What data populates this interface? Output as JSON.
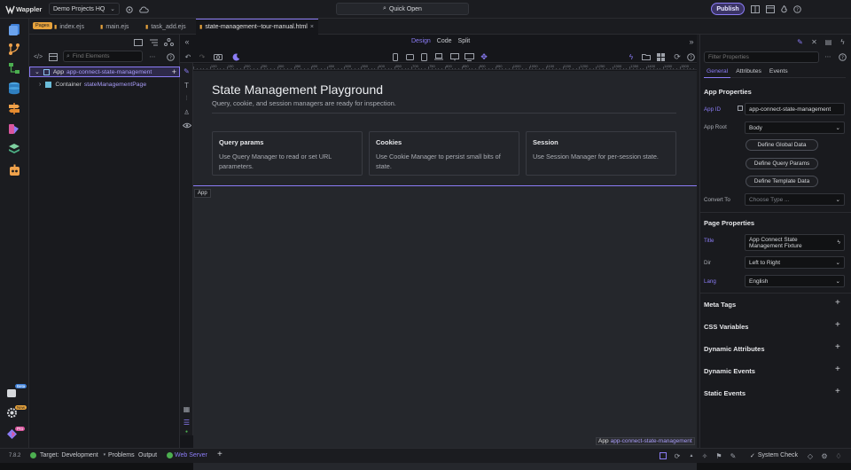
{
  "topbar": {
    "app_name": "Wappler",
    "project": "Demo Projects HQ",
    "quick_open": "Quick Open",
    "publish": "Publish"
  },
  "left_badges": {
    "beta": "Beta",
    "new": "New",
    "pro": "Pro"
  },
  "tabs": {
    "pages_badge": "Pages",
    "files": [
      "index.ejs",
      "main.ejs",
      "task_add.ejs"
    ],
    "active": "state-management--tour-manual.html"
  },
  "panel": {
    "find_placeholder": "Find Elements",
    "tree": {
      "app_label": "App",
      "app_id": "app-connect-state-management",
      "container_label": "Container",
      "container_id": "stateManagementPage"
    }
  },
  "view_modes": {
    "design": "Design",
    "code": "Code",
    "split": "Split"
  },
  "canvas": {
    "title": "State Management Playground",
    "subtitle": "Query, cookie, and session managers are ready for inspection.",
    "cards": [
      {
        "heading": "Query params",
        "text": "Use Query Manager to read or set URL parameters."
      },
      {
        "heading": "Cookies",
        "text": "Use Cookie Manager to persist small bits of state."
      },
      {
        "heading": "Session",
        "text": "Use Session Manager for per-session state."
      }
    ],
    "app_tag": "App",
    "breadcrumb_label": "App",
    "breadcrumb_id": "app-connect-state-management"
  },
  "ruler_ticks": [
    "100",
    "150",
    "200",
    "250",
    "300",
    "350",
    "400",
    "450",
    "500",
    "550",
    "600",
    "650",
    "700",
    "750",
    "800",
    "850",
    "900",
    "950",
    "1000",
    "1050",
    "1100",
    "1150",
    "1200",
    "1250",
    "1300",
    "1350",
    "1400",
    "1450",
    "1500"
  ],
  "props": {
    "filter_placeholder": "Filter Properties",
    "tabs": [
      "General",
      "Attributes",
      "Events"
    ],
    "app_properties": "App Properties",
    "app_id_label": "App ID",
    "app_id_value": "app-connect-state-management",
    "app_root_label": "App Root",
    "app_root_value": "Body",
    "buttons": [
      "Define Global Data",
      "Define Query Params",
      "Define Template Data"
    ],
    "convert_label": "Convert To",
    "convert_placeholder": "Choose Type ...",
    "page_properties": "Page Properties",
    "title_label": "Title",
    "title_value": "App Connect State Management Fixture",
    "dir_label": "Dir",
    "dir_value": "Left to Right",
    "lang_label": "Lang",
    "lang_value": "English",
    "sections": [
      "Meta Tags",
      "CSS Variables",
      "Dynamic Attributes",
      "Dynamic Events",
      "Static Events"
    ]
  },
  "status": {
    "version": "7.8.2",
    "target_label": "Target:",
    "target_value": "Development",
    "problems": "Problems",
    "output": "Output",
    "web_server": "Web Server",
    "system_check": "System Check"
  },
  "colors": {
    "accent": "#8b7cf6",
    "green": "#4caf50",
    "orange": "#e6a23c"
  }
}
